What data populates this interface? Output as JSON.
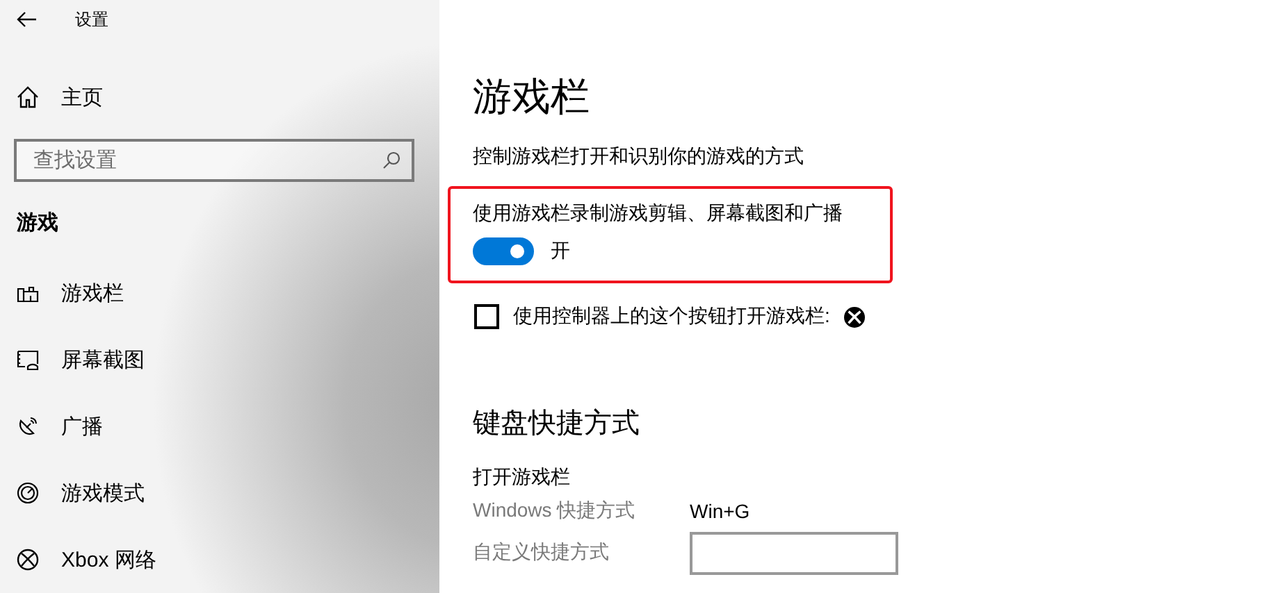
{
  "window": {
    "title": "设置"
  },
  "sidebar": {
    "home": "主页",
    "search": {
      "placeholder": "查找设置"
    },
    "section": "游戏",
    "items": [
      {
        "label": "游戏栏"
      },
      {
        "label": "屏幕截图"
      },
      {
        "label": "广播"
      },
      {
        "label": "游戏模式"
      },
      {
        "label": "Xbox 网络"
      }
    ]
  },
  "main": {
    "title": "游戏栏",
    "description": "控制游戏栏打开和识别你的游戏的方式",
    "toggle": {
      "label": "使用游戏栏录制游戏剪辑、屏幕截图和广播",
      "on": true,
      "state_text": "开",
      "highlighted": true
    },
    "checkbox": {
      "label": "使用控制器上的这个按钮打开游戏栏:",
      "checked": false
    },
    "shortcuts": {
      "title": "键盘快捷方式",
      "group": "打开游戏栏",
      "rows": [
        {
          "kind": "text",
          "label": "Windows 快捷方式",
          "value": "Win+G"
        },
        {
          "kind": "field",
          "label": "自定义快捷方式"
        }
      ]
    }
  }
}
